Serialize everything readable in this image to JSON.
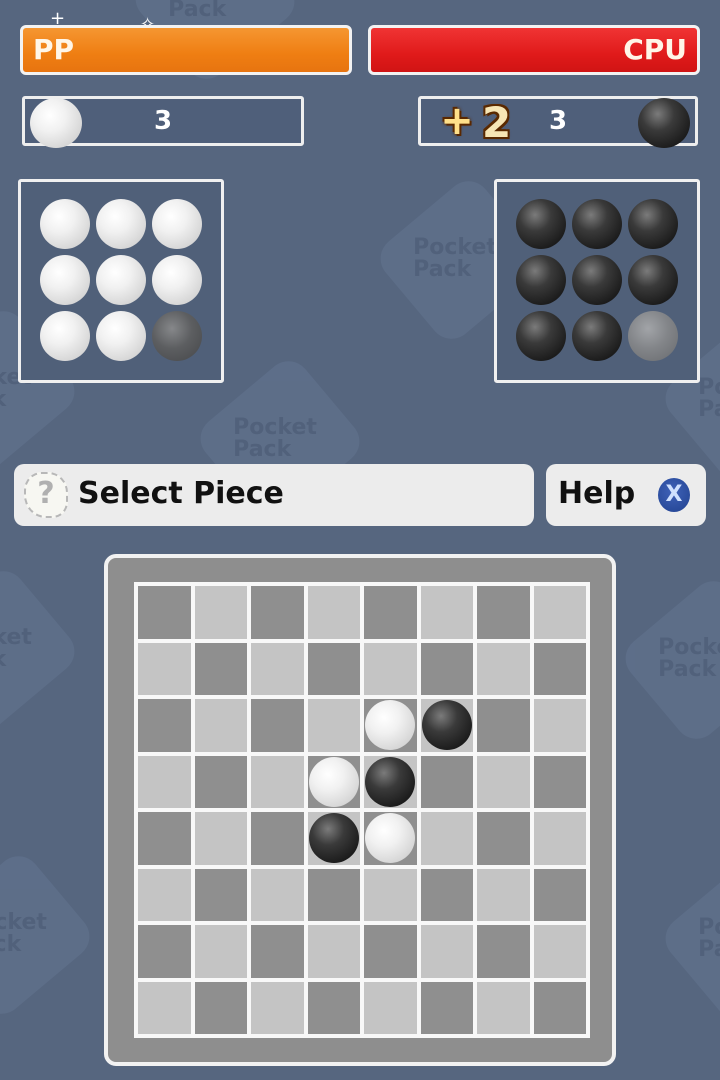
{
  "players": {
    "human": {
      "name": "PP",
      "color": "white",
      "score": "3",
      "bar_color": "#ef7e12"
    },
    "cpu": {
      "name": "CPU",
      "color": "black",
      "score": "3",
      "bar_color": "#e01a1a",
      "bonus_sign": "+",
      "bonus_value": "2"
    }
  },
  "trays": {
    "human": {
      "stones": [
        "white",
        "white",
        "white",
        "white",
        "white",
        "white",
        "white",
        "white",
        "used"
      ]
    },
    "cpu": {
      "stones": [
        "black",
        "black",
        "black",
        "black",
        "black",
        "black",
        "black",
        "black",
        "used"
      ]
    }
  },
  "message": {
    "icon": "question-icon",
    "text": "Select Piece"
  },
  "help": {
    "label": "Help",
    "icon": "x-button-icon"
  },
  "watermark": {
    "text": "Pocket\nPack"
  },
  "board": {
    "size": 8,
    "top_left_dark": true,
    "pieces": [
      {
        "row": 2,
        "col": 4,
        "color": "white"
      },
      {
        "row": 2,
        "col": 5,
        "color": "black"
      },
      {
        "row": 3,
        "col": 3,
        "color": "white"
      },
      {
        "row": 3,
        "col": 4,
        "color": "black"
      },
      {
        "row": 4,
        "col": 3,
        "color": "black"
      },
      {
        "row": 4,
        "col": 4,
        "color": "white"
      }
    ]
  }
}
